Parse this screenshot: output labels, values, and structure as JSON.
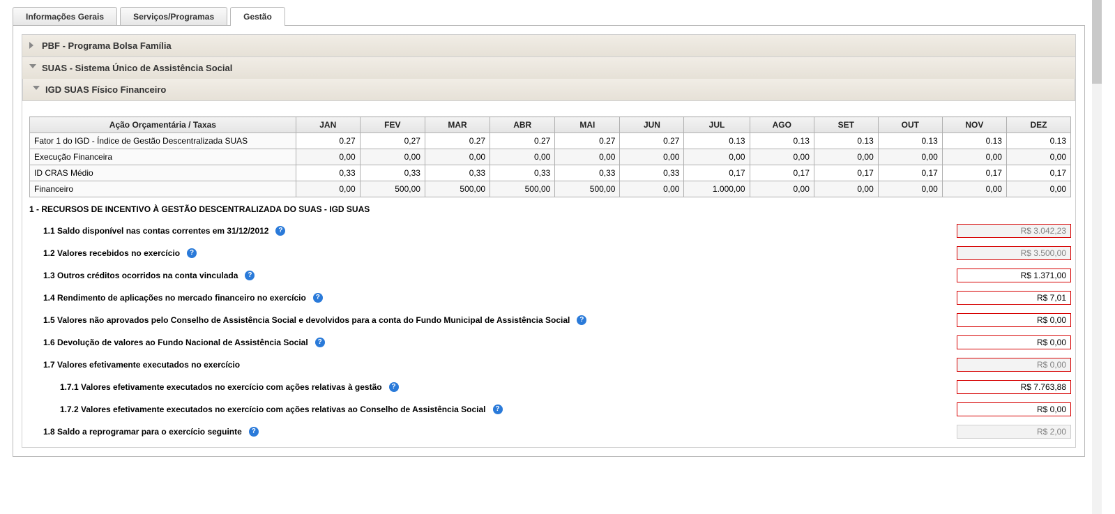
{
  "tabs": {
    "info": "Informações Gerais",
    "serv": "Serviços/Programas",
    "gestao": "Gestão"
  },
  "accordions": {
    "pbf": "PBF - Programa Bolsa Família",
    "suas": "SUAS - Sistema Único de Assistência Social",
    "igd": "IGD SUAS Físico Financeiro"
  },
  "table": {
    "col0": "Ação Orçamentária / Taxas",
    "months": [
      "JAN",
      "FEV",
      "MAR",
      "ABR",
      "MAI",
      "JUN",
      "JUL",
      "AGO",
      "SET",
      "OUT",
      "NOV",
      "DEZ"
    ],
    "rows": [
      {
        "label": "Fator 1 do IGD - Índice de Gestão Descentralizada SUAS",
        "v": [
          "0.27",
          "0,27",
          "0.27",
          "0.27",
          "0.27",
          "0.27",
          "0.13",
          "0.13",
          "0.13",
          "0.13",
          "0.13",
          "0.13"
        ]
      },
      {
        "label": "Execução Financeira",
        "v": [
          "0,00",
          "0,00",
          "0,00",
          "0,00",
          "0,00",
          "0,00",
          "0,00",
          "0,00",
          "0,00",
          "0,00",
          "0,00",
          "0,00"
        ]
      },
      {
        "label": "ID CRAS Médio",
        "v": [
          "0,33",
          "0,33",
          "0,33",
          "0,33",
          "0,33",
          "0,33",
          "0,17",
          "0,17",
          "0,17",
          "0,17",
          "0,17",
          "0,17"
        ]
      },
      {
        "label": "Financeiro",
        "v": [
          "0,00",
          "500,00",
          "500,00",
          "500,00",
          "500,00",
          "0,00",
          "1.000,00",
          "0,00",
          "0,00",
          "0,00",
          "0,00",
          "0,00"
        ]
      }
    ]
  },
  "section1": {
    "title": "1 - RECURSOS DE INCENTIVO À GESTÃO DESCENTRALIZADA DO SUAS - IGD SUAS",
    "items": [
      {
        "label": "1.1 Saldo disponível nas contas correntes em 31/12/2012",
        "value": "R$ 3.042,23",
        "readonly": true,
        "help": true
      },
      {
        "label": "1.2 Valores recebidos no exercício",
        "value": "R$ 3.500,00",
        "readonly": true,
        "help": true
      },
      {
        "label": "1.3 Outros créditos ocorridos na conta vinculada",
        "value": "R$ 1.371,00",
        "readonly": false,
        "help": true
      },
      {
        "label": "1.4 Rendimento de aplicações no mercado financeiro no exercício",
        "value": "R$ 7,01",
        "readonly": false,
        "help": true
      },
      {
        "label": "1.5 Valores não aprovados pelo Conselho de Assistência Social e devolvidos para a conta do Fundo Municipal de Assistência Social",
        "value": "R$ 0,00",
        "readonly": false,
        "help": true
      },
      {
        "label": "1.6 Devolução de valores ao Fundo Nacional de Assistência Social",
        "value": "R$ 0,00",
        "readonly": false,
        "help": true
      },
      {
        "label": "1.7 Valores efetivamente executados no exercício",
        "value": "R$ 0,00",
        "readonly": true,
        "help": false
      },
      {
        "label": "1.7.1 Valores efetivamente executados no exercício com ações relativas à gestão",
        "value": "R$ 7.763,88",
        "readonly": false,
        "help": true,
        "sub": true
      },
      {
        "label": "1.7.2 Valores efetivamente executados no exercício com ações relativas ao Conselho de Assistência Social",
        "value": "R$ 0,00",
        "readonly": false,
        "help": true,
        "sub": true
      },
      {
        "label": "1.8 Saldo a reprogramar para o exercício seguinte",
        "value": "R$ 2,00",
        "readonly": true,
        "help": true,
        "noRedBorder": true
      }
    ]
  }
}
